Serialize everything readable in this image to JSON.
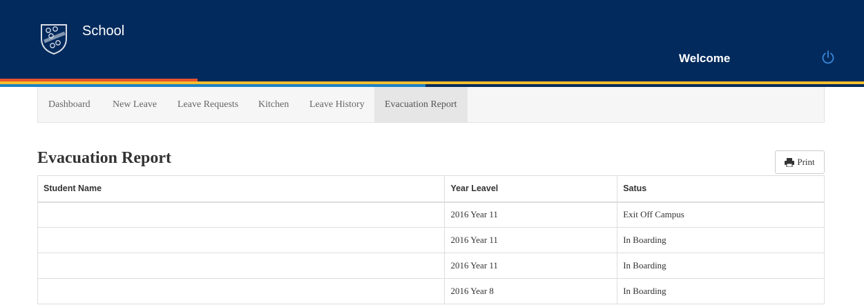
{
  "header": {
    "title": "School",
    "welcome": "Welcome",
    "logo_icon": "school-crest-icon",
    "power_icon": "power-icon"
  },
  "colors": {
    "header_bg": "#022a5c",
    "stripe_orange": "#e8542c",
    "stripe_yellow": "#f3be2e",
    "stripe_blue": "#1b82c6"
  },
  "nav": {
    "items": [
      {
        "label": "Dashboard"
      },
      {
        "label": "New Leave"
      },
      {
        "label": "Leave Requests"
      },
      {
        "label": "Kitchen"
      },
      {
        "label": "Leave History"
      },
      {
        "label": "Evacuation Report",
        "active": true
      }
    ]
  },
  "page": {
    "title": "Evacuation Report",
    "print_label": "Print",
    "print_icon": "printer-icon"
  },
  "table": {
    "columns": [
      "Student Name",
      "Year Leavel",
      "Satus"
    ],
    "rows": [
      {
        "name": "",
        "year": "2016 Year 11",
        "status": "Exit Off Campus"
      },
      {
        "name": "",
        "year": "2016 Year 11",
        "status": "In Boarding"
      },
      {
        "name": "",
        "year": "2016 Year 11",
        "status": "In Boarding"
      },
      {
        "name": "",
        "year": "2016 Year 8",
        "status": "In Boarding"
      }
    ]
  }
}
